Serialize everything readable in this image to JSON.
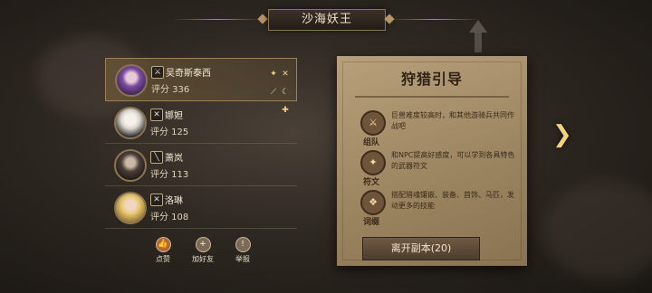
{
  "header": {
    "title": "沙海妖王"
  },
  "players": [
    {
      "name": "吴奇斯泰西",
      "score_label": "评分 336",
      "class_icon": "⚔",
      "avatar": "avatar-purple",
      "selected": true
    },
    {
      "name": "娜妲",
      "score_label": "评分 125",
      "class_icon": "✕",
      "avatar": "avatar-white",
      "selected": false
    },
    {
      "name": "萧岚",
      "score_label": "评分 113",
      "class_icon": "╲",
      "avatar": "avatar-dark",
      "selected": false
    },
    {
      "name": "洛琳",
      "score_label": "评分 108",
      "class_icon": "✕",
      "avatar": "avatar-blonde",
      "selected": false
    }
  ],
  "actions": [
    {
      "label": "点赞",
      "icon": "thumbs-up-icon"
    },
    {
      "label": "加好友",
      "icon": "add-friend-icon"
    },
    {
      "label": "举报",
      "icon": "report-icon"
    }
  ],
  "guide": {
    "title": "狩猎引导",
    "tips": [
      {
        "label": "组队",
        "text": "巨兽难度较高时，和其他游骑兵共同作战吧",
        "icon": "team-icon"
      },
      {
        "label": "符文",
        "text": "和NPC提高好感度，可以学到各具特色的武器符文",
        "icon": "rune-icon"
      },
      {
        "label": "词缀",
        "text": "搭配猎魂镶嵌、装备、首饰、马匹，发动更多的技能",
        "icon": "affix-icon"
      }
    ],
    "leave_button": "离开副本(20)"
  },
  "colors": {
    "accent": "#f3d27c",
    "parchment": "#b8a07a",
    "panel": "#2e2822"
  }
}
